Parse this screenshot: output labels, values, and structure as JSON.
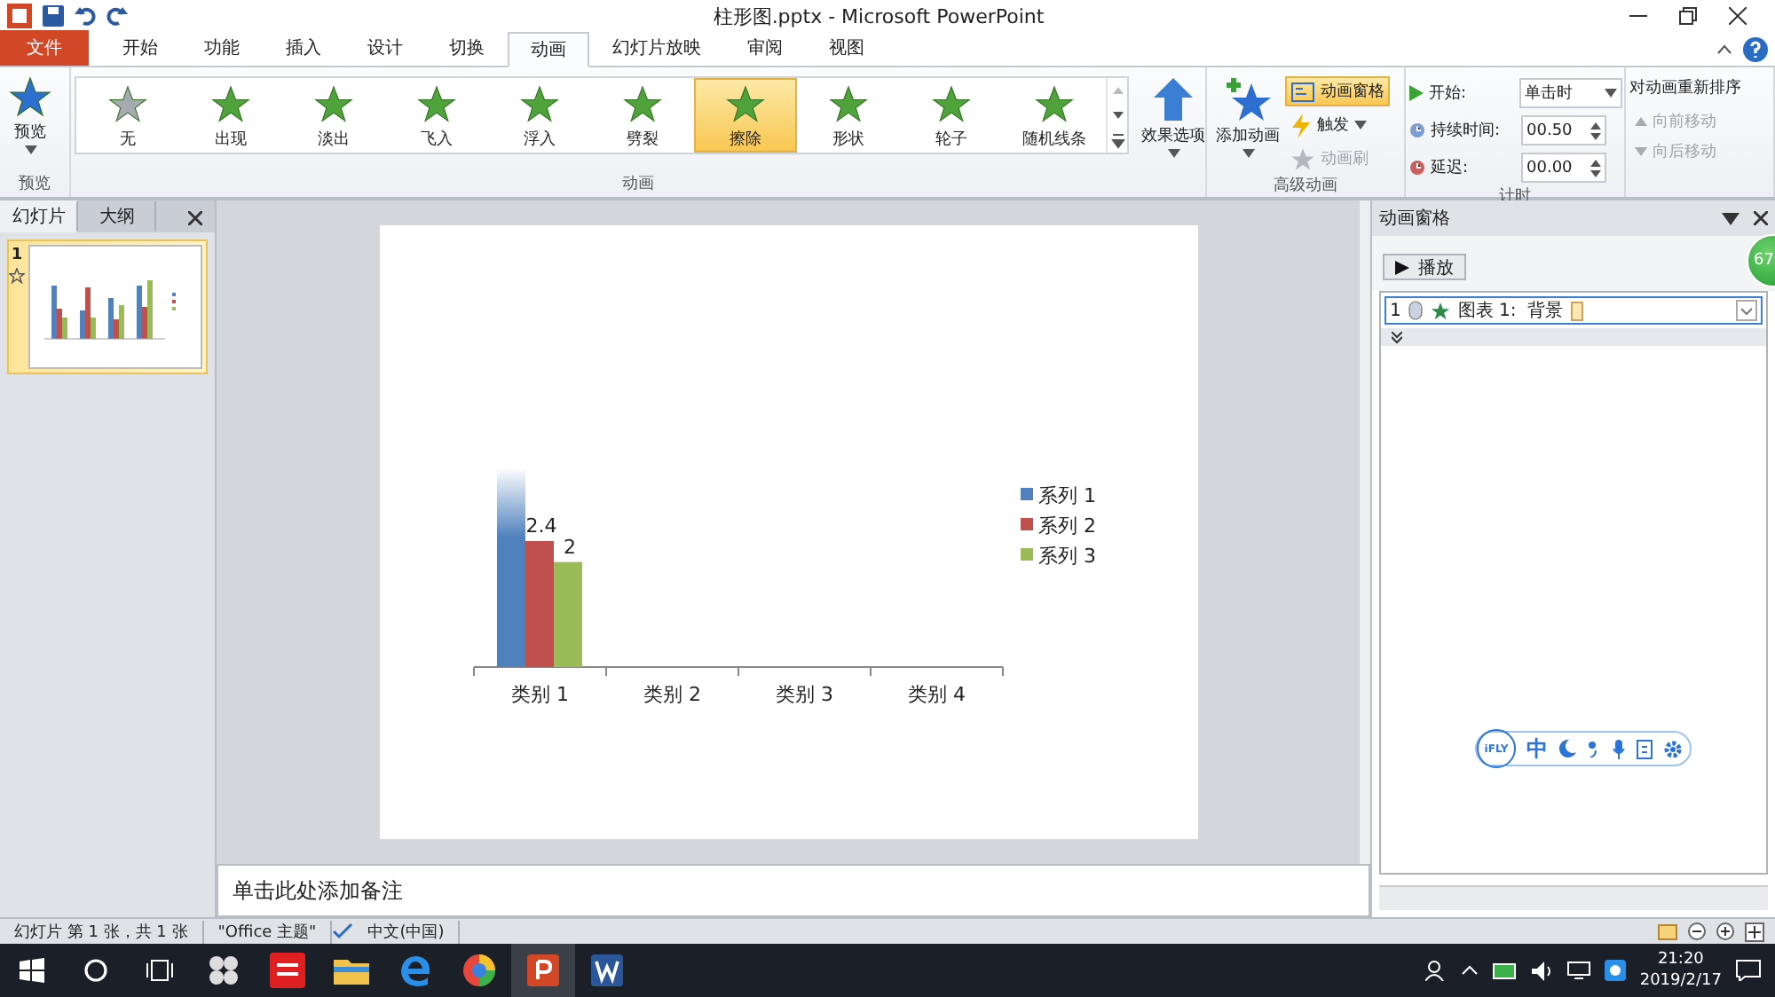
{
  "title_bar": {
    "title": "柱形图.pptx - Microsoft PowerPoint"
  },
  "ribbon_tabs": [
    {
      "label": "文件",
      "kind": "file",
      "selected": false
    },
    {
      "label": "开始",
      "kind": "tab",
      "selected": false
    },
    {
      "label": "功能",
      "kind": "tab",
      "selected": false
    },
    {
      "label": "插入",
      "kind": "tab",
      "selected": false
    },
    {
      "label": "设计",
      "kind": "tab",
      "selected": false
    },
    {
      "label": "切换",
      "kind": "tab",
      "selected": false
    },
    {
      "label": "动画",
      "kind": "tab",
      "selected": true
    },
    {
      "label": "幻灯片放映",
      "kind": "tab",
      "selected": false
    },
    {
      "label": "审阅",
      "kind": "tab",
      "selected": false
    },
    {
      "label": "视图",
      "kind": "tab",
      "selected": false
    }
  ],
  "ribbon": {
    "preview": {
      "button": "预览",
      "group": "预览"
    },
    "animation_gallery": {
      "group": "动画",
      "items": [
        {
          "label": "无",
          "kind": "none",
          "selected": false
        },
        {
          "label": "出现",
          "kind": "effect",
          "selected": false
        },
        {
          "label": "淡出",
          "kind": "effect",
          "selected": false
        },
        {
          "label": "飞入",
          "kind": "effect",
          "selected": false
        },
        {
          "label": "浮入",
          "kind": "effect",
          "selected": false
        },
        {
          "label": "劈裂",
          "kind": "effect",
          "selected": false
        },
        {
          "label": "擦除",
          "kind": "effect",
          "selected": true
        },
        {
          "label": "形状",
          "kind": "effect",
          "selected": false
        },
        {
          "label": "轮子",
          "kind": "effect",
          "selected": false
        },
        {
          "label": "随机线条",
          "kind": "effect",
          "selected": false
        }
      ]
    },
    "effect_options": "效果选项",
    "advanced": {
      "group": "高级动画",
      "add": "添加动画",
      "buttons": [
        {
          "label": "动画窗格",
          "selected": true,
          "disabled": false
        },
        {
          "label": "触发",
          "selected": false,
          "disabled": false
        },
        {
          "label": "动画刷",
          "selected": false,
          "disabled": true
        }
      ]
    },
    "timing": {
      "group": "计时",
      "fields": [
        {
          "label": "开始:",
          "value": "单击时",
          "kind": "dropdown"
        },
        {
          "label": "持续时间:",
          "value": "00.50",
          "kind": "spinner"
        },
        {
          "label": "延迟:",
          "value": "00.00",
          "kind": "spinner"
        }
      ]
    },
    "reorder": {
      "title": "对动画重新排序",
      "buttons": [
        {
          "label": "向前移动",
          "disabled": true
        },
        {
          "label": "向后移动",
          "disabled": true
        }
      ]
    }
  },
  "slides_pane": {
    "tabs": [
      {
        "label": "幻灯片",
        "selected": true
      },
      {
        "label": "大纲",
        "selected": false
      }
    ],
    "slides": [
      {
        "number": "1",
        "selected": true
      }
    ]
  },
  "slide": {
    "chart_data": {
      "type": "bar",
      "categories": [
        "类别 1",
        "类别 2",
        "类别 3",
        "类别 4"
      ],
      "series": [
        {
          "name": "系列 1",
          "color": "#4f81bd",
          "values": [
            3.8,
            null,
            null,
            null
          ],
          "value_labels": [
            null,
            null,
            null,
            null
          ]
        },
        {
          "name": "系列 2",
          "color": "#c0504d",
          "values": [
            2.4,
            null,
            null,
            null
          ],
          "value_labels": [
            "2.4",
            null,
            null,
            null
          ]
        },
        {
          "name": "系列 3",
          "color": "#9bbb59",
          "values": [
            2,
            null,
            null,
            null
          ],
          "value_labels": [
            "2",
            null,
            null,
            null
          ]
        }
      ],
      "legend": true
    }
  },
  "notes": {
    "placeholder": "单击此处添加备注"
  },
  "animation_pane": {
    "title": "动画窗格",
    "play": "播放",
    "items": [
      {
        "number": "1",
        "label": "图表 1:  背景",
        "selected": true
      }
    ]
  },
  "badge": "67",
  "ime_toolbar": {
    "logo": "iFLY",
    "mode": "中"
  },
  "status_bar": {
    "items": [
      "幻灯片 第 1 张，共 1 张",
      "\"Office 主题\"",
      "中文(中国)"
    ]
  },
  "taskbar": {
    "time": "21:20",
    "date": "2019/2/17"
  }
}
